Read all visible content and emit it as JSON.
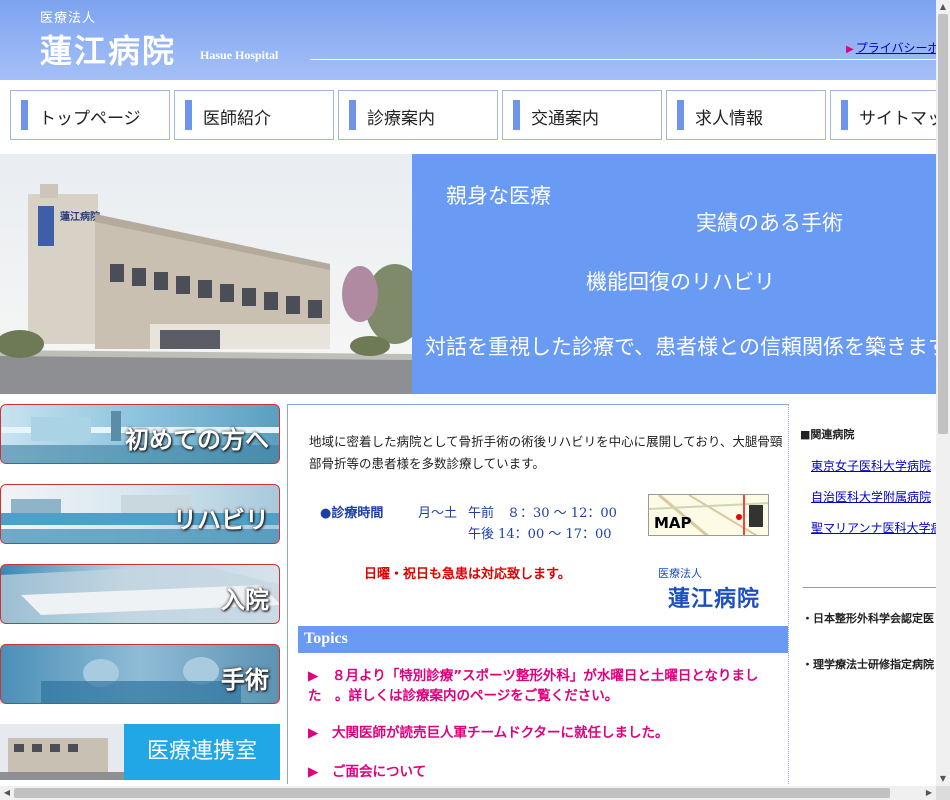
{
  "header": {
    "corp": "医療法人",
    "name": "蓮江病院",
    "name_en": "Hasue Hospital",
    "privacy_link": "プライバシーポ"
  },
  "nav": {
    "items": [
      {
        "label": "トップページ"
      },
      {
        "label": "医師紹介"
      },
      {
        "label": "診療案内"
      },
      {
        "label": "交通案内"
      },
      {
        "label": "求人情報"
      },
      {
        "label": "サイトマップ"
      }
    ]
  },
  "hero": {
    "line1": "親身な医療",
    "line2": "実績のある手術",
    "line3": "機能回復のリハビリ",
    "line4": "対話を重視した診療で、患者様との信頼関係を築きます"
  },
  "banners": {
    "first_visit": "初めての方へ",
    "rehab": "リハビリ",
    "admission": "入院",
    "surgery": "手術",
    "liaison": "医療連携室"
  },
  "main": {
    "intro": "地域に密着した病院として骨折手術の術後リハビリを中心に展開しており、大腿骨頸部骨折等の患者様を多数診療しています。",
    "hours_label": "●診療時間",
    "hours_days": "月～土",
    "hours_am": "午前　８：30 ～ 12：00",
    "hours_pm": "午後 14：00 ～ 17：00",
    "map_label": "MAP",
    "emergency": "日曜・祝日も急患は対応致します。",
    "sign_corp": "医療法人",
    "sign_name": "蓮江病院",
    "topics_title": "Topics",
    "topics": [
      {
        "arrow": "▶",
        "text": "８月より「特別診療”スポーツ整形外科」が水曜日と土曜日となりました　。詳しくは診療案内のページをご覧ください。"
      },
      {
        "arrow": "▶",
        "text": "大関医師が読売巨人軍チームドクターに就任しました。"
      },
      {
        "arrow": "▶",
        "text": "ご面会について"
      }
    ]
  },
  "right": {
    "heading": "■関連病院",
    "links": [
      {
        "label": "東京女子医科大学病院"
      },
      {
        "label": "自治医科大学附属病院"
      },
      {
        "label": "聖マリアンナ医科大学病院"
      }
    ],
    "notes": [
      {
        "label": "・日本整形外科学会認定医"
      },
      {
        "label": "・理学療法士研修指定病院"
      }
    ]
  },
  "colors": {
    "header_blue": "#7da3f0",
    "hero_blue": "#6a9bf4",
    "topic_pink": "#e0007f",
    "liaison_blue": "#22a7e6"
  }
}
